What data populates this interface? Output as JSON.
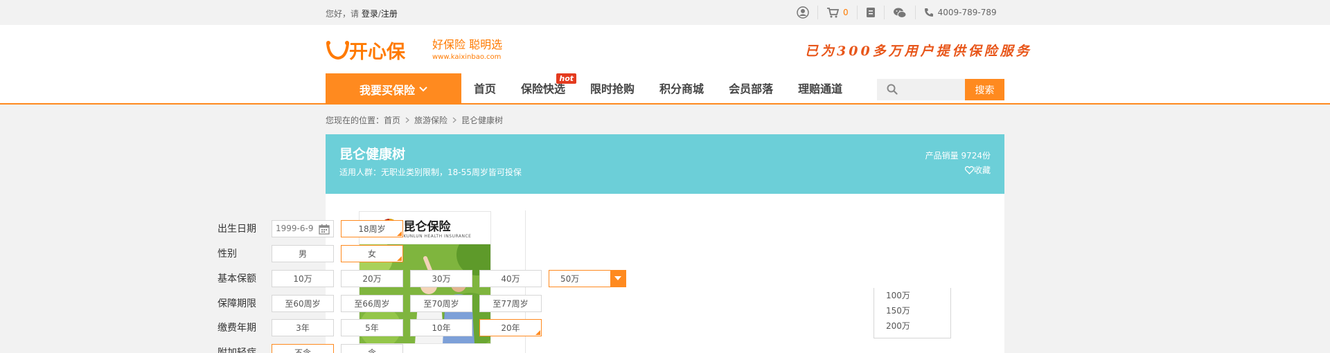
{
  "topbar": {
    "greeting": "您好，请",
    "login": "登录",
    "slash": "/",
    "register": "注册",
    "cart_count": "0",
    "phone": "4009-789-789"
  },
  "header": {
    "logo_text": "开心保",
    "logo_tagline": "好保险 聪明选",
    "logo_url": "www.kaixinbao.com",
    "slogan": "已为300多万用户提供保险服务"
  },
  "nav": {
    "buy_label": "我要买保险",
    "links": [
      "首页",
      "保险快选",
      "限时抢购",
      "积分商城",
      "会员部落",
      "理赔通道"
    ],
    "hot_badge": "hot",
    "search_button": "搜索",
    "search_placeholder": ""
  },
  "breadcrumb": {
    "prefix": "您现在的位置：",
    "items": [
      "首页",
      "旅游保险",
      "昆仑健康树"
    ]
  },
  "product": {
    "title": "昆仑健康树",
    "subtitle": "适用人群：无职业类别限制，18-55周岁皆可投保",
    "sales_label": "产品销量",
    "sales_value": "9724份",
    "favorite": "收藏",
    "brand_name": "昆仑保险",
    "brand_sub": "KUNLUN HEALTH INSURANCE"
  },
  "form": {
    "birth": {
      "label": "出生日期",
      "date": "1999-6-9",
      "age": "18周岁"
    },
    "gender": {
      "label": "性别",
      "options": [
        "男",
        "女"
      ],
      "selected": "女"
    },
    "coverage": {
      "label": "基本保额",
      "options": [
        "10万",
        "20万",
        "30万",
        "40万"
      ],
      "dropdown_value": "50万",
      "dropdown_options": [
        "100万",
        "150万",
        "200万"
      ]
    },
    "period": {
      "label": "保障期限",
      "options": [
        "至60周岁",
        "至66周岁",
        "至70周岁",
        "至77周岁"
      ]
    },
    "payment": {
      "label": "缴费年期",
      "options": [
        "3年",
        "5年",
        "10年",
        "20年"
      ],
      "selected": "20年"
    },
    "rider": {
      "label": "附加轻症",
      "options": [
        "不含",
        "含"
      ],
      "selected": "不含"
    }
  },
  "colors": {
    "accent": "#ff8a1f",
    "banner": "#6ccfd8",
    "slogan": "#e8561a"
  }
}
